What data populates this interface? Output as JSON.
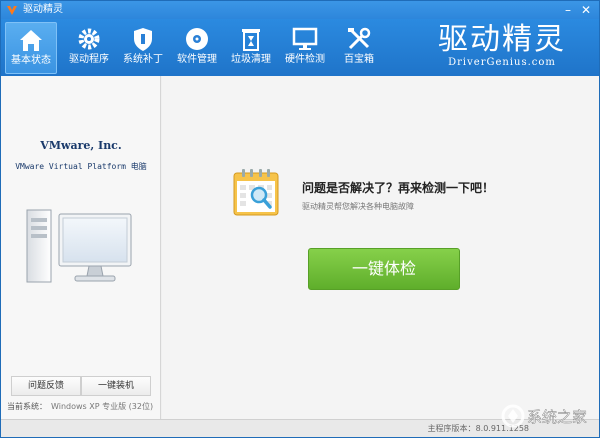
{
  "window": {
    "title": "驱动精灵"
  },
  "toolbar": {
    "items": [
      {
        "label": "基本状态",
        "icon": "home-icon",
        "active": true
      },
      {
        "label": "驱动程序",
        "icon": "gear-icon"
      },
      {
        "label": "系统补丁",
        "icon": "shield-icon"
      },
      {
        "label": "软件管理",
        "icon": "disc-icon"
      },
      {
        "label": "垃圾清理",
        "icon": "trash-icon"
      },
      {
        "label": "硬件检测",
        "icon": "monitor-icon"
      },
      {
        "label": "百宝箱",
        "icon": "tools-icon"
      }
    ]
  },
  "brand": {
    "name": "驱动精灵",
    "url": "DriverGenius.com"
  },
  "sidebar": {
    "vendor": "VMware, Inc.",
    "model": "VMware Virtual Platform 电脑",
    "feedback_label": "问题反馈",
    "install_label": "一键装机",
    "system_label": "当前系统：",
    "system_value": "Windows XP 专业版 (32位)"
  },
  "main": {
    "headline": "问题是否解决了？再来检测一下吧！",
    "subline": "驱动精灵帮您解决各种电脑故障",
    "check_label": "一键体检"
  },
  "status": {
    "version_label": "主程序版本：",
    "version_value": "8.0.911.1258"
  },
  "watermark": {
    "text": "系统之家"
  },
  "colors": {
    "accent": "#2b8ae0",
    "button_green": "#6cbd36"
  }
}
